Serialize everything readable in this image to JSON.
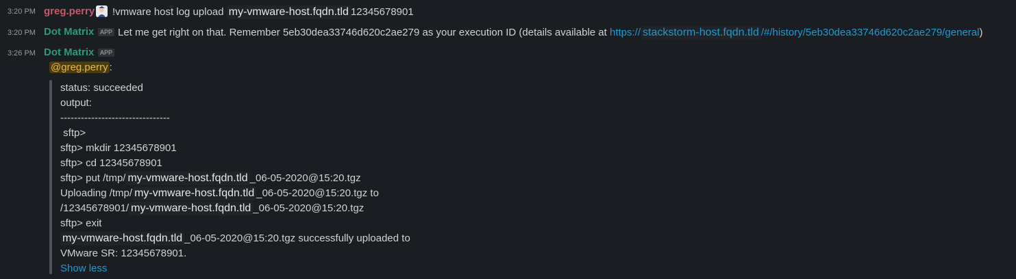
{
  "messages": [
    {
      "time": "3:20 PM",
      "user": "greg.perry",
      "text_pre": "!vmware host log upload",
      "host": "my-vmware-host.fqdn.tld",
      "text_post": "12345678901"
    },
    {
      "time": "3:20 PM",
      "user": "Dot Matrix",
      "badge": "APP",
      "text_pre": "Let me get right on that. Remember 5eb30dea33746d620c2ae279 as your execution ID (details available at ",
      "link_pre": "https://",
      "link_host": "stackstorm-host.fqdn.tld",
      "link_post": "/#/history/5eb30dea33746d620c2ae279/general",
      "text_post": ")"
    },
    {
      "time": "3:26 PM",
      "user": "Dot Matrix",
      "badge": "APP",
      "mention": "@greg.perry",
      "mention_suffix": ":"
    }
  ],
  "output": {
    "status": "status: succeeded",
    "output_label": "output:",
    "divider": "--------------------------------",
    "sftp_prompt": " sftp>",
    "mkdir": "sftp> mkdir 12345678901",
    "cd": "sftp> cd 12345678901",
    "put_pre": "sftp> put /tmp/",
    "host": "my-vmware-host.fqdn.tld",
    "file_suffix": "_06-05-2020@15:20.tgz",
    "uploading_pre": "Uploading /tmp/",
    "uploading_suffix": "_06-05-2020@15:20.tgz to",
    "dest_pre": "/12345678901/",
    "dest_suffix": "_06-05-2020@15:20.tgz",
    "exit": "sftp> exit",
    "success_suffix": "_06-05-2020@15:20.tgz successfully uploaded to",
    "sr": "VMware SR: 12345678901.",
    "show_less": "Show less"
  }
}
